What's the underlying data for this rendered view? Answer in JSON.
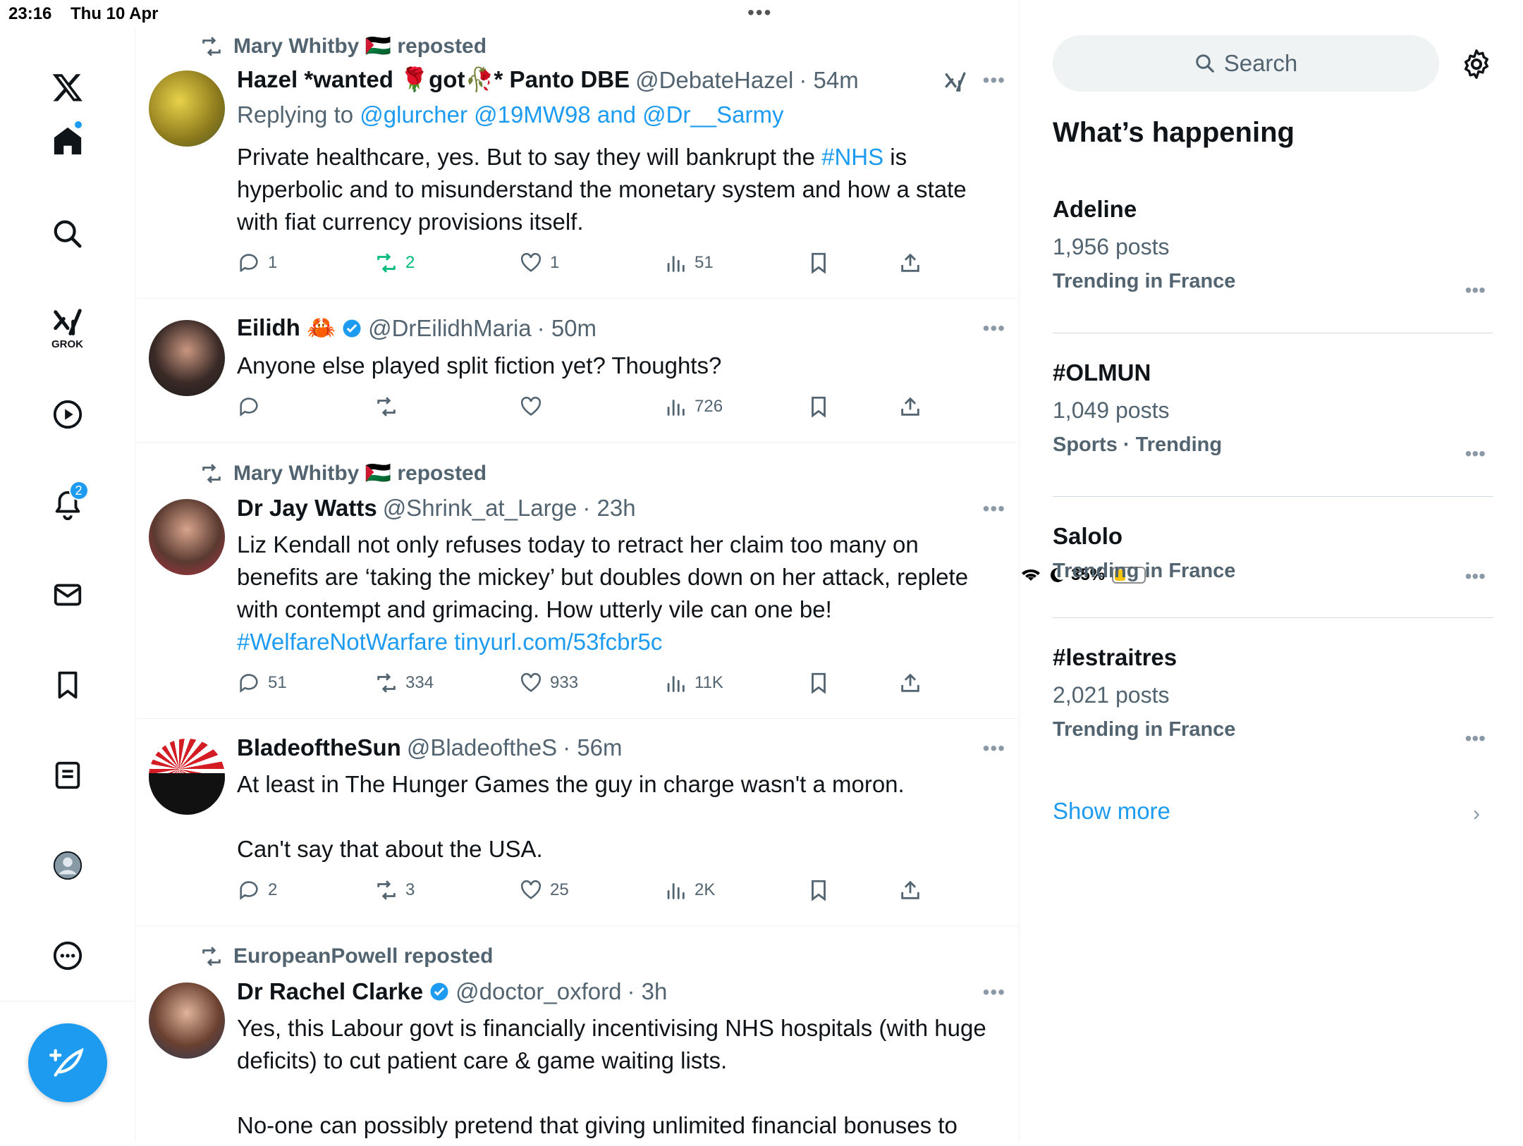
{
  "status": {
    "time": "23:16",
    "date": "Thu 10 Apr",
    "battery": "35%",
    "battery_level": 0.35
  },
  "nav": {
    "items": [
      "home",
      "explore",
      "grok",
      "video",
      "notifications",
      "messages",
      "bookmarks",
      "lists",
      "profile",
      "more"
    ],
    "grok_label": "GROK",
    "notifications_count": "2"
  },
  "feed": {
    "posts": [
      {
        "repost_by": "Mary Whitby 🇵🇸 reposted",
        "name": "Hazel *wanted 🌹got🥀* Panto DBE",
        "handle": "@DebateHazel",
        "time": "· 54m",
        "replying_prefix": "Replying to ",
        "replying_to": "@glurcher @19MW98 and @Dr__Sarmy",
        "text_before": "Private healthcare, yes.  But to say they will bankrupt the ",
        "text_link": "#NHS",
        "text_after": " is hyperbolic and to misunderstand the monetary system and how a state with fiat currency provisions itself.",
        "replies": "1",
        "reposts": "2",
        "likes": "1",
        "views": "51"
      },
      {
        "name": "Eilidh 🦀",
        "handle": "@DrEilidhMaria",
        "time": "· 50m",
        "text": "Anyone else played split fiction yet? Thoughts?",
        "replies": "",
        "reposts": "",
        "likes": "",
        "views": "726"
      },
      {
        "repost_by": "Mary Whitby 🇵🇸 reposted",
        "name": "Dr Jay Watts",
        "handle": "@Shrink_at_Large",
        "time": "· 23h",
        "text": "Liz Kendall not only refuses today to retract her claim too many on benefits are ‘taking the mickey’ but doubles down on her attack, replete with contempt and grimacing. How utterly vile can one be!",
        "text_link": "#WelfareNotWarfare tinyurl.com/53fcbr5c",
        "replies": "51",
        "reposts": "334",
        "likes": "933",
        "views": "11K"
      },
      {
        "name": "BladeoftheSun",
        "handle": "@BladeoftheS",
        "time": "· 56m",
        "text1": "At least in The Hunger Games the guy in charge wasn't a moron.",
        "text2": "Can't say that about the USA.",
        "replies": "2",
        "reposts": "3",
        "likes": "25",
        "views": "2K"
      },
      {
        "repost_by": "EuropeanPowell reposted",
        "name": "Dr Rachel Clarke",
        "handle": "@doctor_oxford",
        "time": "· 3h",
        "text1": "Yes, this Labour govt is financially incentivising NHS hospitals (with huge deficits) to cut patient care & game waiting lists.",
        "text2": "No-one can possibly pretend that giving unlimited financial bonuses to"
      }
    ]
  },
  "sidebar": {
    "search_placeholder": "Search",
    "title": "What’s happening",
    "trends": [
      {
        "name": "Adeline",
        "count": "1,956 posts",
        "meta": "Trending in France"
      },
      {
        "name": "#OLMUN",
        "count": "1,049 posts",
        "meta": "Sports · Trending"
      },
      {
        "name": "Salolo",
        "count": "",
        "meta": "Trending in France"
      },
      {
        "name": "#lestraitres",
        "count": "2,021 posts",
        "meta": "Trending in France"
      }
    ],
    "show_more": "Show more"
  },
  "colors": {
    "accent": "#1d9bf0",
    "repost_green": "#00ba7c",
    "text_secondary": "#536471"
  }
}
